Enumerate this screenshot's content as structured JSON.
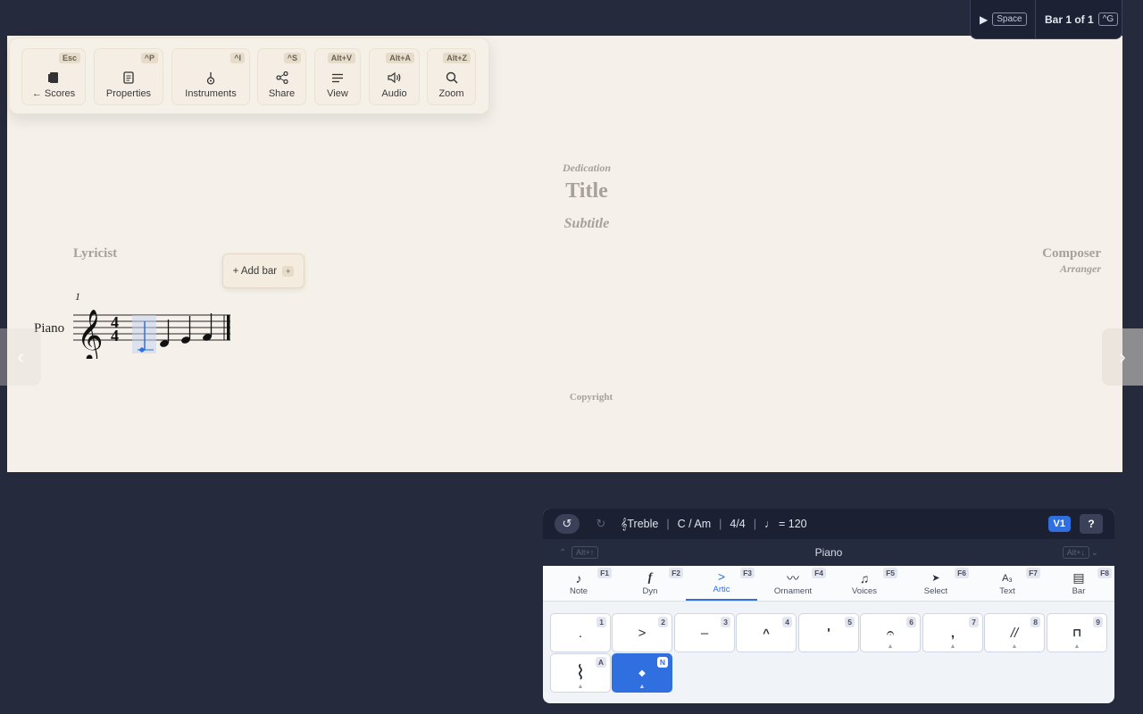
{
  "toolbar": {
    "buttons": [
      {
        "label": "← Scores",
        "key": "Esc"
      },
      {
        "label": "Properties",
        "key": "^P"
      },
      {
        "label": "Instruments",
        "key": "^I"
      },
      {
        "label": "Share",
        "key": "^S"
      },
      {
        "label": "View",
        "key": "Alt+V"
      },
      {
        "label": "Audio",
        "key": "Alt+A"
      },
      {
        "label": "Zoom",
        "key": "Alt+Z"
      }
    ]
  },
  "playback": {
    "play_key": "Space",
    "bar_label": "Bar 1 of 1",
    "goto_key": "^G"
  },
  "score": {
    "dedication": "Dedication",
    "title": "Title",
    "subtitle": "Subtitle",
    "lyricist": "Lyricist",
    "composer": "Composer",
    "arranger": "Arranger",
    "copyright": "Copyright",
    "instrument": "Piano",
    "bar_number": "1",
    "add_bar_label": "+ Add bar",
    "add_bar_key": "+"
  },
  "panel": {
    "clef": "Treble",
    "key": "C / Am",
    "time": "4/4",
    "tempo": "♩ = 120",
    "voice": "V1",
    "help": "?",
    "instrument": "Piano",
    "prev_instr_key": "Alt+↑",
    "next_instr_key": "Alt+↓",
    "tabs": [
      {
        "label": "Note",
        "key": "F1",
        "icon": "♪"
      },
      {
        "label": "Dyn",
        "key": "F2",
        "icon": "f"
      },
      {
        "label": "Artic",
        "key": "F3",
        "icon": ">"
      },
      {
        "label": "Ornament",
        "key": "F4",
        "icon": "〰"
      },
      {
        "label": "Voices",
        "key": "F5",
        "icon": "♫"
      },
      {
        "label": "Select",
        "key": "F6",
        "icon": "➤"
      },
      {
        "label": "Text",
        "key": "F7",
        "icon": "A₃"
      },
      {
        "label": "Bar",
        "key": "F8",
        "icon": "▤"
      }
    ],
    "articulations": [
      {
        "symbol": ".",
        "key": "1"
      },
      {
        "symbol": ">",
        "key": "2"
      },
      {
        "symbol": "–",
        "key": "3"
      },
      {
        "symbol": "^",
        "key": "4"
      },
      {
        "symbol": "'",
        "key": "5"
      },
      {
        "symbol": "𝄐",
        "key": "6"
      },
      {
        "symbol": ",",
        "key": "7"
      },
      {
        "symbol": "//",
        "key": "8"
      },
      {
        "symbol": "⊓",
        "key": "9"
      },
      {
        "symbol": "⌇",
        "key": "A"
      },
      {
        "symbol": "◆",
        "key": "N"
      }
    ]
  }
}
